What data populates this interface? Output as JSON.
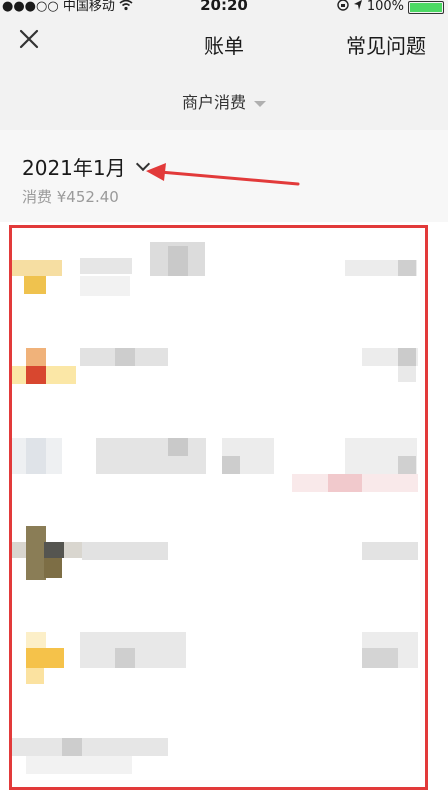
{
  "status": {
    "carrier": "●●●○○ 中国移动",
    "time": "20:20",
    "battery": "100%",
    "battery_level": 1.0
  },
  "nav": {
    "title": "账单",
    "faq": "常见问题"
  },
  "filter": {
    "label": "商户消费"
  },
  "summary": {
    "month": "2021年1月",
    "total": "消费 ¥452.40"
  },
  "icons": {
    "close": "close-icon",
    "filter_caret": "caret-down-icon",
    "month_chevron": "chevron-down-icon",
    "wifi": "wifi-icon",
    "location": "location-icon",
    "lock": "rotation-lock-icon",
    "battery": "battery-icon"
  },
  "colors": {
    "annotation_red": "#e23a3a",
    "battery_green": "#4cd964"
  }
}
